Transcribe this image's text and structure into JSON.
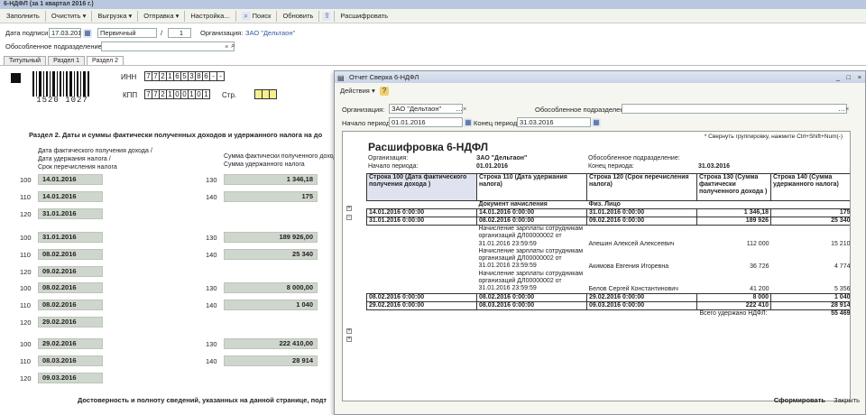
{
  "window_title": "6-НДФЛ (за 1 квартал 2016 г.)",
  "toolbar": {
    "fill": "Заполнить",
    "clear": "Очистить",
    "export": "Выгрузка",
    "send": "Отправка",
    "settings": "Настройка...",
    "search": "Поиск",
    "refresh": "Обновить",
    "decrypt": "Расшифровать"
  },
  "header": {
    "sign_date_label": "Дата подписи:",
    "sign_date": "17.03.2016",
    "doc_type": "Первичный",
    "slash": "/",
    "corr_num": "1",
    "org_label": "Организация:",
    "org": "ЗАО \"Дельтаон\"",
    "subdiv_label": "Обособленное подразделение:",
    "subdiv": ""
  },
  "tabs": [
    "Титульный",
    "Раздел 1",
    "Раздел 2"
  ],
  "form": {
    "barcode_number": "1520 1027",
    "inn_label": "ИНН",
    "inn": [
      "7",
      "7",
      "2",
      "1",
      "6",
      "5",
      "3",
      "8",
      "6",
      "-",
      "-"
    ],
    "kpp_label": "КПП",
    "kpp": [
      "7",
      "7",
      "2",
      "1",
      "0",
      "0",
      "1",
      "0",
      "1"
    ],
    "page_label": "Стр.",
    "section_title": "Раздел 2.  Даты и суммы фактически полученных доходов и удержанного налога на до",
    "col1_header": "Дата фактического получения дохода /\nДата удержания налога /\nСрок перечисления налога",
    "col2_header": "Сумма фактически полученного дохода /\nСумма удержанного налога",
    "groups": [
      {
        "c100": "14.01.2016",
        "c110": "14.01.2016",
        "c120": "31.01.2016",
        "s130": "1 346,18",
        "s140": "175"
      },
      {
        "c100": "31.01.2016",
        "c110": "08.02.2016",
        "c120": "09.02.2016",
        "s130": "189 926,00",
        "s140": "25 340"
      },
      {
        "c100": "08.02.2016",
        "c110": "08.02.2016",
        "c120": "29.02.2016",
        "s130": "8 000,00",
        "s140": "1 040"
      },
      {
        "c100": "29.02.2016",
        "c110": "08.03.2016",
        "c120": "09.03.2016",
        "s130": "222 410,00",
        "s140": "28 914"
      }
    ],
    "codes": {
      "c100": "100",
      "c110": "110",
      "c120": "120",
      "c130": "130",
      "c140": "140"
    },
    "footer": "Достоверность и полноту сведений, указанных на данной странице, подт"
  },
  "report": {
    "title": "Отчет  Сверка 6-НДФЛ",
    "actions": "Действия",
    "org_label": "Организация:",
    "org": "ЗАО \"Дельтаон\"",
    "subdiv_label": "Обособленное подразделение:",
    "subdiv": "",
    "start_label": "Начало периода:",
    "start": "01.01.2016",
    "end_label": "Конец периода:",
    "end": "31.03.2016",
    "hint": "* Свернуть группировку, нажмите Ctrl+Shift+Num(-)",
    "heading": "Расшифровка 6-НДФЛ",
    "info": {
      "org_label": "Организация:",
      "org": "ЗАО \"Дельтаон\"",
      "start_label": "Начало периода:",
      "start": "01.01.2016",
      "subdiv_label": "Обособленное подразделение:",
      "end_label": "Конец периода:",
      "end": "31.03.2016"
    },
    "columns": [
      "Строка 100 (Дата фактического получения дохода )",
      "Строка 110 (Дата удержания налога)",
      "Строка 120 (Срок перечисления налога)",
      "Строка 130 (Сумма фактически полученного дохода )",
      "Строка 140 (Сумма удержанного налога)"
    ],
    "subcolumns": [
      "Документ начисления",
      "Физ. Лицо"
    ],
    "rows": [
      {
        "c1": "14.01.2016 0:00:00",
        "c2": "14.01.2016 0:00:00",
        "c3": "31.01.2016 0:00:00",
        "c4": "1 346,18",
        "c5": "175",
        "bold": true
      },
      {
        "c1": "31.01.2016 0:00:00",
        "c2": "08.02.2016 0:00:00",
        "c3": "09.02.2016 0:00:00",
        "c4": "189 926",
        "c5": "25 340",
        "bold": true
      },
      {
        "c2": "Начисление зарплаты сотрудникам организаций ДЛ00000002 от 31.01.2016 23:59:59",
        "c3": "Апешин Алексей Алексеевич",
        "c4": "112 000",
        "c5": "15 210"
      },
      {
        "c2": "Начисление зарплаты сотрудникам организаций ДЛ00000002 от 31.01.2016 23:59:59",
        "c3": "Акимова Евгения Игоревна",
        "c4": "36 726",
        "c5": "4 774"
      },
      {
        "c2": "Начисление зарплаты сотрудникам организаций ДЛ00000002 от 31.01.2016 23:59:59",
        "c3": "Белов Сергей Константинович",
        "c4": "41 200",
        "c5": "5 356"
      },
      {
        "c1": "08.02.2016 0:00:00",
        "c2": "08.02.2016 0:00:00",
        "c3": "29.02.2016 0:00:00",
        "c4": "8 000",
        "c5": "1 040",
        "bold": true
      },
      {
        "c1": "29.02.2016 0:00:00",
        "c2": "08.03.2016 0:00:00",
        "c3": "09.03.2016 0:00:00",
        "c4": "222 410",
        "c5": "28 914",
        "bold": true
      }
    ],
    "total_label": "Всего удержано НДФЛ:",
    "total": "55 469",
    "generate": "Сформировать",
    "close": "Закрыть"
  }
}
